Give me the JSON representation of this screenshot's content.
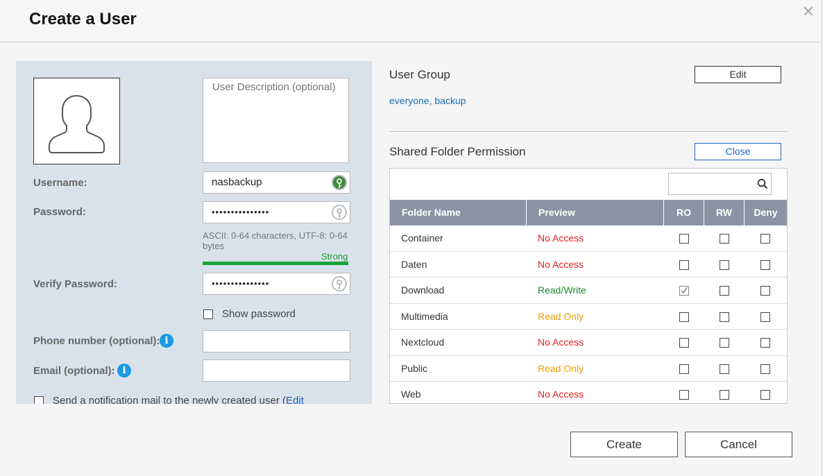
{
  "dialog": {
    "title": "Create a User",
    "close_glyph": "✕"
  },
  "left": {
    "description_placeholder": "User Description (optional)",
    "username_label": "Username:",
    "username_value": "nasbackup",
    "password_label": "Password:",
    "password_value": "•••••••••••••••",
    "password_hint": "ASCII: 0-64 characters, UTF-8: 0-64 bytes",
    "strength_label": "Strong",
    "verify_label": "Verify Password:",
    "verify_value": "•••••••••••••••",
    "show_password_label": "Show password",
    "phone_label": "Phone number (optional):",
    "email_label": "Email (optional):",
    "info_glyph": "i",
    "notify_label": "Send a notification mail to the newly created user (",
    "notify_link": "Edit"
  },
  "right": {
    "user_group_title": "User Group",
    "edit_button": "Edit",
    "groups_value": "everyone, backup",
    "shared_folder_title": "Shared Folder Permission",
    "close_button": "Close",
    "table": {
      "headers": [
        "Folder Name",
        "Preview",
        "RO",
        "RW",
        "Deny"
      ],
      "rows": [
        {
          "name": "Container",
          "preview": "No Access",
          "status": "red",
          "ro": false,
          "rw": false,
          "deny": false
        },
        {
          "name": "Daten",
          "preview": "No Access",
          "status": "red",
          "ro": false,
          "rw": false,
          "deny": false
        },
        {
          "name": "Download",
          "preview": "Read/Write",
          "status": "green",
          "ro": true,
          "rw": false,
          "deny": false
        },
        {
          "name": "Multimedia",
          "preview": "Read Only",
          "status": "orange",
          "ro": false,
          "rw": false,
          "deny": false
        },
        {
          "name": "Nextcloud",
          "preview": "No Access",
          "status": "red",
          "ro": false,
          "rw": false,
          "deny": false
        },
        {
          "name": "Public",
          "preview": "Read Only",
          "status": "orange",
          "ro": false,
          "rw": false,
          "deny": false
        },
        {
          "name": "Web",
          "preview": "No Access",
          "status": "red",
          "ro": false,
          "rw": false,
          "deny": false
        }
      ]
    }
  },
  "footer": {
    "create_button": "Create",
    "cancel_button": "Cancel"
  },
  "colors": {
    "panel_bg": "#d9e2ea",
    "strength_green": "#14a538",
    "no_access": "#e02020",
    "read_write": "#1c8a2e",
    "read_only": "#f0a000",
    "table_header": "#8a94a4",
    "info_blue": "#1a9ae6"
  }
}
